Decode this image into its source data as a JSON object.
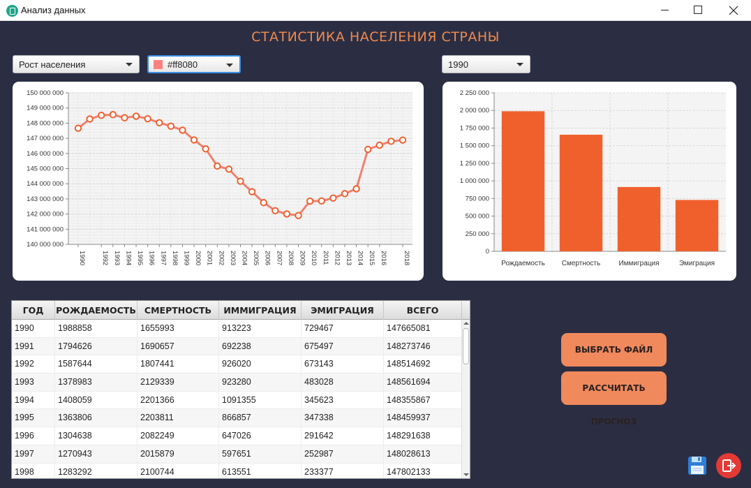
{
  "window": {
    "title": "Анализ данных"
  },
  "page_title": "СТАТИСТИКА НАСЕЛЕНИЯ СТРАНЫ",
  "controls": {
    "metric_select": "Рост населения",
    "color_select": "#ff8080",
    "year_select": "1990"
  },
  "colors": {
    "line": "#f08070",
    "bar": "#f0602d",
    "accent": "#ef8a4f",
    "background": "#2b2e43",
    "button": "#f0895c"
  },
  "chart_data": [
    {
      "type": "line",
      "x": [
        "1990",
        "1991",
        "1992",
        "1993",
        "1994",
        "1995",
        "1996",
        "1997",
        "1998",
        "1999",
        "2000",
        "2001",
        "2002",
        "2003",
        "2004",
        "2005",
        "2006",
        "2007",
        "2008",
        "2009",
        "2010",
        "2011",
        "2012",
        "2013",
        "2014",
        "2015",
        "2016",
        "2017",
        "2018"
      ],
      "xticks": [
        "1990",
        "1992",
        "1993",
        "1994",
        "1995",
        "1996",
        "1997",
        "1998",
        "1999",
        "2000",
        "2001",
        "2002",
        "2003",
        "2004",
        "2005",
        "2006",
        "2007",
        "2008",
        "2009",
        "2010",
        "2011",
        "2012",
        "2013",
        "2014",
        "2015",
        "2016",
        "2018"
      ],
      "values": [
        147665081,
        148273746,
        148514692,
        148561694,
        148355867,
        148459937,
        148291638,
        148028613,
        147802133,
        147539426,
        146890128,
        146303611,
        145166731,
        144963650,
        144168205,
        143474219,
        142753551,
        142220968,
        142008838,
        141903979,
        142856536,
        142865433,
        143056383,
        143347059,
        143666931,
        146267288,
        146544710,
        146804372,
        146880432
      ],
      "ylim": [
        140000000,
        150000000
      ],
      "yticks": [
        "140 000 000",
        "141 000 000",
        "142 000 000",
        "143 000 000",
        "144 000 000",
        "145 000 000",
        "146 000 000",
        "147 000 000",
        "148 000 000",
        "149 000 000",
        "150 000 000"
      ],
      "grid": true
    },
    {
      "type": "bar",
      "categories": [
        "Рождаемость",
        "Смертность",
        "Иммиграция",
        "Эмиграция"
      ],
      "values": [
        1988858,
        1655993,
        913223,
        729467
      ],
      "ylim": [
        0,
        2250000
      ],
      "yticks": [
        "0",
        "250 000",
        "500 000",
        "750 000",
        "1 000 000",
        "1 250 000",
        "1 500 000",
        "1 750 000",
        "2 000 000",
        "2 250 000"
      ],
      "grid": true
    }
  ],
  "table": {
    "headers": [
      "ГОД",
      "РОЖДАЕМОСТЬ",
      "СМЕРТНОСТЬ",
      "ИММИГРАЦИЯ",
      "ЭМИГРАЦИЯ",
      "ВСЕГО"
    ],
    "rows": [
      [
        "1990",
        "1988858",
        "1655993",
        "913223",
        "729467",
        "147665081"
      ],
      [
        "1991",
        "1794626",
        "1690657",
        "692238",
        "675497",
        "148273746"
      ],
      [
        "1992",
        "1587644",
        "1807441",
        "926020",
        "673143",
        "148514692"
      ],
      [
        "1993",
        "1378983",
        "2129339",
        "923280",
        "483028",
        "148561694"
      ],
      [
        "1994",
        "1408059",
        "2201366",
        "1091355",
        "345623",
        "148355867"
      ],
      [
        "1995",
        "1363806",
        "2203811",
        "866857",
        "347338",
        "148459937"
      ],
      [
        "1996",
        "1304638",
        "2082249",
        "647026",
        "291642",
        "148291638"
      ],
      [
        "1997",
        "1270943",
        "2015879",
        "597651",
        "252987",
        "148028613"
      ],
      [
        "1998",
        "1283292",
        "2100744",
        "613551",
        "233377",
        "147802133"
      ]
    ]
  },
  "buttons": {
    "choose_file": "ВЫБРАТЬ ФАЙЛ",
    "calculate_forecast": "РАССЧИТАТЬ ПРОГНОЗ"
  },
  "icons": {
    "app": "chart-app-icon",
    "save": "floppy-disk-icon",
    "exit": "exit-icon"
  }
}
